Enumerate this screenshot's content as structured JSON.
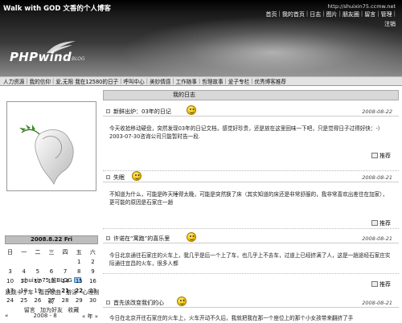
{
  "header": {
    "site_title": "Walk with GOD 文香的个人博客",
    "url": "http://shuixin75.ccmw.net",
    "nav": [
      "首页",
      "我的首页",
      "日志",
      "图片",
      "朋友圈",
      "留言",
      "管理",
      "注销"
    ],
    "login": "注销",
    "logo": "PHPwind",
    "logo_sub": "BLOG"
  },
  "categories": [
    "人力资源",
    "我的信仰",
    "爱,无限 我在12580的日子",
    "呼叫中心",
    "美妙情感",
    "工作随事",
    "哲理故事",
    "爱子专栏",
    "优秀博客推荐"
  ],
  "sidebar": {
    "owner": "shuixin75 的BLOG",
    "links_line1": [
      "跳跳卡丁车",
      "福音歌曲",
      "游泳",
      "心理测试"
    ],
    "links_line2": [
      "留言",
      "加为好友",
      "收藏"
    ],
    "date": "2008.8.22 Fri",
    "calendar_header": [
      "日",
      "一",
      "二",
      "三",
      "四",
      "五",
      "六"
    ],
    "calendar_rows": [
      [
        "",
        "",
        "",
        "",
        "",
        "1",
        "2"
      ],
      [
        "3",
        "4",
        "5",
        "6",
        "7",
        "8",
        "9"
      ],
      [
        "10",
        "11",
        "12",
        "13",
        "14",
        "15",
        "16"
      ],
      [
        "17",
        "18",
        "19",
        "20",
        "21",
        "22",
        "23"
      ],
      [
        "24",
        "25",
        "26",
        "27",
        "28",
        "29",
        "30"
      ],
      [
        "31",
        "",
        "",
        "",
        "",
        "",
        ""
      ]
    ],
    "cal_prev": "« 2008 - 8 »",
    "cal_prev_left": "«",
    "cal_month": "2008 - 8",
    "cal_next": "« 年 »"
  },
  "main": {
    "section_title": "我的日志",
    "posts": [
      {
        "title": "新鲜出炉：03年的日记",
        "date": "2008-08-22",
        "body": "今天收拾移动硬盘，突然发现03年的日记文档，感觉好珍贵，还是放在这里回味一下吧，只是觉得日子过得好快：-）2003-07-30咨询公司只能暂时告一段.",
        "trackback": "推荐"
      },
      {
        "title": "失眠",
        "date": "2008-08-21",
        "body": "不知道为什么，可能是昨天睡得太晚，可能是突然换了床（其实知道的床还是非常舒服的，我非常喜欢出差住在加家），更可能的原因是石家庄一趟",
        "trackback": "推荐"
      },
      {
        "title": "许诺在“寓跑”的喜乐里",
        "date": "2008-08-21",
        "body": "今日北京通往石家庄的火车上，我几乎是后一个上了车，也几乎上不去车，过道上已经挤满了人，这是一趟途经石家庄实际通往宜昌的火车，很多人都",
        "trackback": "推荐"
      },
      {
        "title": "首先该改变我们的心",
        "date": "2008-08-21",
        "body": "今日在北京开往石家庄的火车上，火车开动不久后，我就把我在那一个座位上的那个小女孩带来翻挤了手",
        "trackback": ""
      }
    ]
  }
}
